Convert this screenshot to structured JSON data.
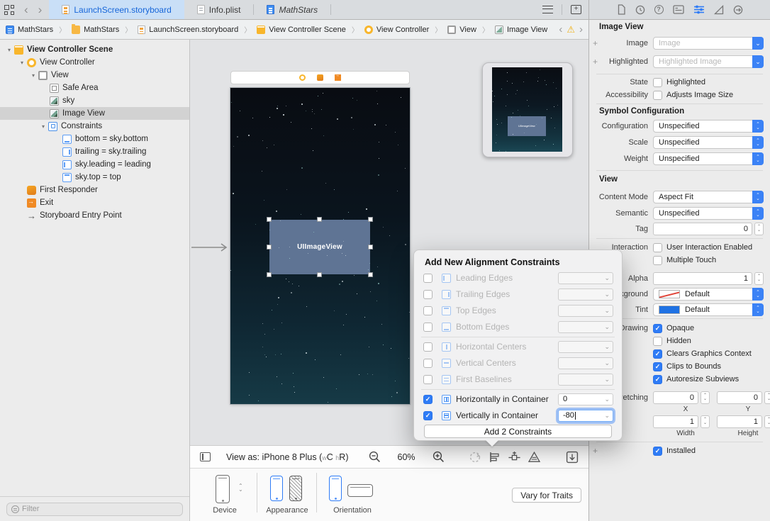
{
  "icons": {
    "plus": "+",
    "check": "✓",
    "warning": "⚠",
    "chev_left": "‹",
    "chev_right": "›",
    "crumb_sep": "〉",
    "disclosure": "▾",
    "dropdown": "⌄",
    "up": "⌃",
    "down": "⌄",
    "question": "?"
  },
  "tabbar": {
    "tabs": [
      "LaunchScreen.storyboard",
      "Info.plist",
      "MathStars"
    ]
  },
  "jumpbar": {
    "items": [
      "MathStars",
      "MathStars",
      "LaunchScreen.storyboard",
      "View Controller Scene",
      "View Controller",
      "View",
      "Image View"
    ]
  },
  "outline": {
    "items": [
      "View Controller Scene",
      "View Controller",
      "View",
      "Safe Area",
      "sky",
      "Image View",
      "Constraints",
      "bottom = sky.bottom",
      "trailing = sky.trailing",
      "sky.leading = leading",
      "sky.top = top",
      "First Responder",
      "Exit",
      "Storyboard Entry Point"
    ]
  },
  "filter": {
    "placeholder": "Filter"
  },
  "canvas": {
    "imageview_label": "UIImageView"
  },
  "bottom_bar": {
    "view_as_prefix": "View as: iPhone 8 Plus (",
    "w_trait": "w",
    "c_trait": "C",
    "h_trait": "h",
    "r_trait": "R",
    "paren_close": ")",
    "zoom_level": "60%"
  },
  "device_bar": {
    "device_label": "Device",
    "appearance_label": "Appearance",
    "orientation_label": "Orientation",
    "vary_button": "Vary for Traits"
  },
  "popover": {
    "title": "Add New Alignment Constraints",
    "rows": [
      {
        "label": "Leading Edges",
        "checked": false,
        "value": ""
      },
      {
        "label": "Trailing Edges",
        "checked": false,
        "value": ""
      },
      {
        "label": "Top Edges",
        "checked": false,
        "value": ""
      },
      {
        "label": "Bottom Edges",
        "checked": false,
        "value": ""
      },
      {
        "label": "Horizontal Centers",
        "checked": false,
        "value": ""
      },
      {
        "label": "Vertical Centers",
        "checked": false,
        "value": ""
      },
      {
        "label": "First Baselines",
        "checked": false,
        "value": ""
      },
      {
        "label": "Horizontally in Container",
        "checked": true,
        "value": "0"
      },
      {
        "label": "Vertically in Container",
        "checked": true,
        "value": "-80"
      }
    ],
    "button": "Add 2 Constraints"
  },
  "inspector": {
    "title": "Image View",
    "image_label": "Image",
    "image_placeholder": "Image",
    "highlighted_label": "Highlighted",
    "highlighted_placeholder": "Highlighted Image",
    "state_label": "State",
    "state_checkbox": "Highlighted",
    "accessibility_label": "Accessibility",
    "accessibility_checkbox": "Adjusts Image Size",
    "symbol_title": "Symbol Configuration",
    "configuration_label": "Configuration",
    "configuration_value": "Unspecified",
    "scale_label": "Scale",
    "scale_value": "Unspecified",
    "weight_label": "Weight",
    "weight_value": "Unspecified",
    "view_title": "View",
    "content_mode_label": "Content Mode",
    "content_mode_value": "Aspect Fit",
    "semantic_label": "Semantic",
    "semantic_value": "Unspecified",
    "tag_label": "Tag",
    "tag_value": "0",
    "interaction_label": "Interaction",
    "interaction_checkbox": "User Interaction Enabled",
    "multiple_touch_checkbox": "Multiple Touch",
    "alpha_label": "Alpha",
    "alpha_value": "1",
    "background_label": "Background",
    "background_value": "Default",
    "tint_label": "Tint",
    "tint_value": "Default",
    "drawing_label": "Drawing",
    "drawing_items": [
      "Opaque",
      "Hidden",
      "Clears Graphics Context",
      "Clips to Bounds",
      "Autoresize Subviews"
    ],
    "stretching_label": "Stretching",
    "stretch_x": "0",
    "stretch_y": "0",
    "stretch_w": "1",
    "stretch_h": "1",
    "x_label": "X",
    "y_label": "Y",
    "width_label": "Width",
    "height_label": "Height",
    "installed_checkbox": "Installed"
  }
}
